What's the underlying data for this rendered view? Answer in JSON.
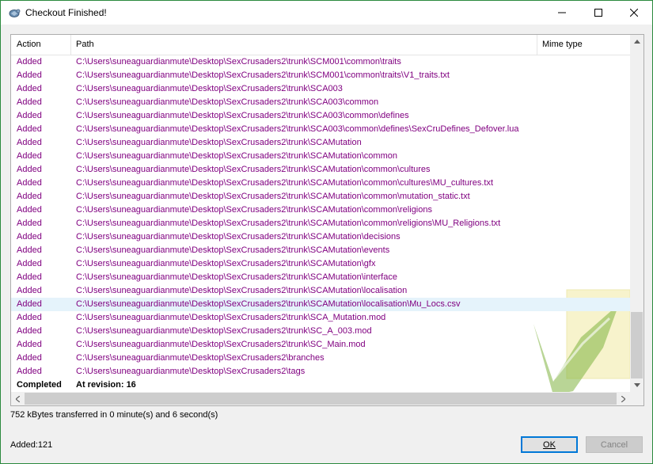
{
  "window": {
    "title": "Checkout Finished!"
  },
  "columns": {
    "action": "Action",
    "path": "Path",
    "mime": "Mime type"
  },
  "rows": [
    {
      "action": "Added",
      "path": "C:\\Users\\suneaguardianmute\\Desktop\\SexCrusaders2\\trunk\\SCM001\\common\\traits"
    },
    {
      "action": "Added",
      "path": "C:\\Users\\suneaguardianmute\\Desktop\\SexCrusaders2\\trunk\\SCM001\\common\\traits\\V1_traits.txt"
    },
    {
      "action": "Added",
      "path": "C:\\Users\\suneaguardianmute\\Desktop\\SexCrusaders2\\trunk\\SCA003"
    },
    {
      "action": "Added",
      "path": "C:\\Users\\suneaguardianmute\\Desktop\\SexCrusaders2\\trunk\\SCA003\\common"
    },
    {
      "action": "Added",
      "path": "C:\\Users\\suneaguardianmute\\Desktop\\SexCrusaders2\\trunk\\SCA003\\common\\defines"
    },
    {
      "action": "Added",
      "path": "C:\\Users\\suneaguardianmute\\Desktop\\SexCrusaders2\\trunk\\SCA003\\common\\defines\\SexCruDefines_Defover.lua"
    },
    {
      "action": "Added",
      "path": "C:\\Users\\suneaguardianmute\\Desktop\\SexCrusaders2\\trunk\\SCAMutation"
    },
    {
      "action": "Added",
      "path": "C:\\Users\\suneaguardianmute\\Desktop\\SexCrusaders2\\trunk\\SCAMutation\\common"
    },
    {
      "action": "Added",
      "path": "C:\\Users\\suneaguardianmute\\Desktop\\SexCrusaders2\\trunk\\SCAMutation\\common\\cultures"
    },
    {
      "action": "Added",
      "path": "C:\\Users\\suneaguardianmute\\Desktop\\SexCrusaders2\\trunk\\SCAMutation\\common\\cultures\\MU_cultures.txt"
    },
    {
      "action": "Added",
      "path": "C:\\Users\\suneaguardianmute\\Desktop\\SexCrusaders2\\trunk\\SCAMutation\\common\\mutation_static.txt"
    },
    {
      "action": "Added",
      "path": "C:\\Users\\suneaguardianmute\\Desktop\\SexCrusaders2\\trunk\\SCAMutation\\common\\religions"
    },
    {
      "action": "Added",
      "path": "C:\\Users\\suneaguardianmute\\Desktop\\SexCrusaders2\\trunk\\SCAMutation\\common\\religions\\MU_Religions.txt"
    },
    {
      "action": "Added",
      "path": "C:\\Users\\suneaguardianmute\\Desktop\\SexCrusaders2\\trunk\\SCAMutation\\decisions"
    },
    {
      "action": "Added",
      "path": "C:\\Users\\suneaguardianmute\\Desktop\\SexCrusaders2\\trunk\\SCAMutation\\events"
    },
    {
      "action": "Added",
      "path": "C:\\Users\\suneaguardianmute\\Desktop\\SexCrusaders2\\trunk\\SCAMutation\\gfx"
    },
    {
      "action": "Added",
      "path": "C:\\Users\\suneaguardianmute\\Desktop\\SexCrusaders2\\trunk\\SCAMutation\\interface"
    },
    {
      "action": "Added",
      "path": "C:\\Users\\suneaguardianmute\\Desktop\\SexCrusaders2\\trunk\\SCAMutation\\localisation"
    },
    {
      "action": "Added",
      "path": "C:\\Users\\suneaguardianmute\\Desktop\\SexCrusaders2\\trunk\\SCAMutation\\localisation\\Mu_Locs.csv"
    },
    {
      "action": "Added",
      "path": "C:\\Users\\suneaguardianmute\\Desktop\\SexCrusaders2\\trunk\\SCA_Mutation.mod"
    },
    {
      "action": "Added",
      "path": "C:\\Users\\suneaguardianmute\\Desktop\\SexCrusaders2\\trunk\\SC_A_003.mod"
    },
    {
      "action": "Added",
      "path": "C:\\Users\\suneaguardianmute\\Desktop\\SexCrusaders2\\trunk\\SC_Main.mod"
    },
    {
      "action": "Added",
      "path": "C:\\Users\\suneaguardianmute\\Desktop\\SexCrusaders2\\branches"
    },
    {
      "action": "Added",
      "path": "C:\\Users\\suneaguardianmute\\Desktop\\SexCrusaders2\\tags"
    },
    {
      "action": "Completed",
      "path": "At revision: 16"
    }
  ],
  "status": {
    "transfer": "752 kBytes transferred in 0 minute(s) and 6 second(s)",
    "added": "Added:121"
  },
  "buttons": {
    "ok": "OK",
    "cancel": "Cancel"
  },
  "colors": {
    "added_text": "#800080",
    "selection": "#e5f3fb",
    "accent": "#0078d7"
  }
}
